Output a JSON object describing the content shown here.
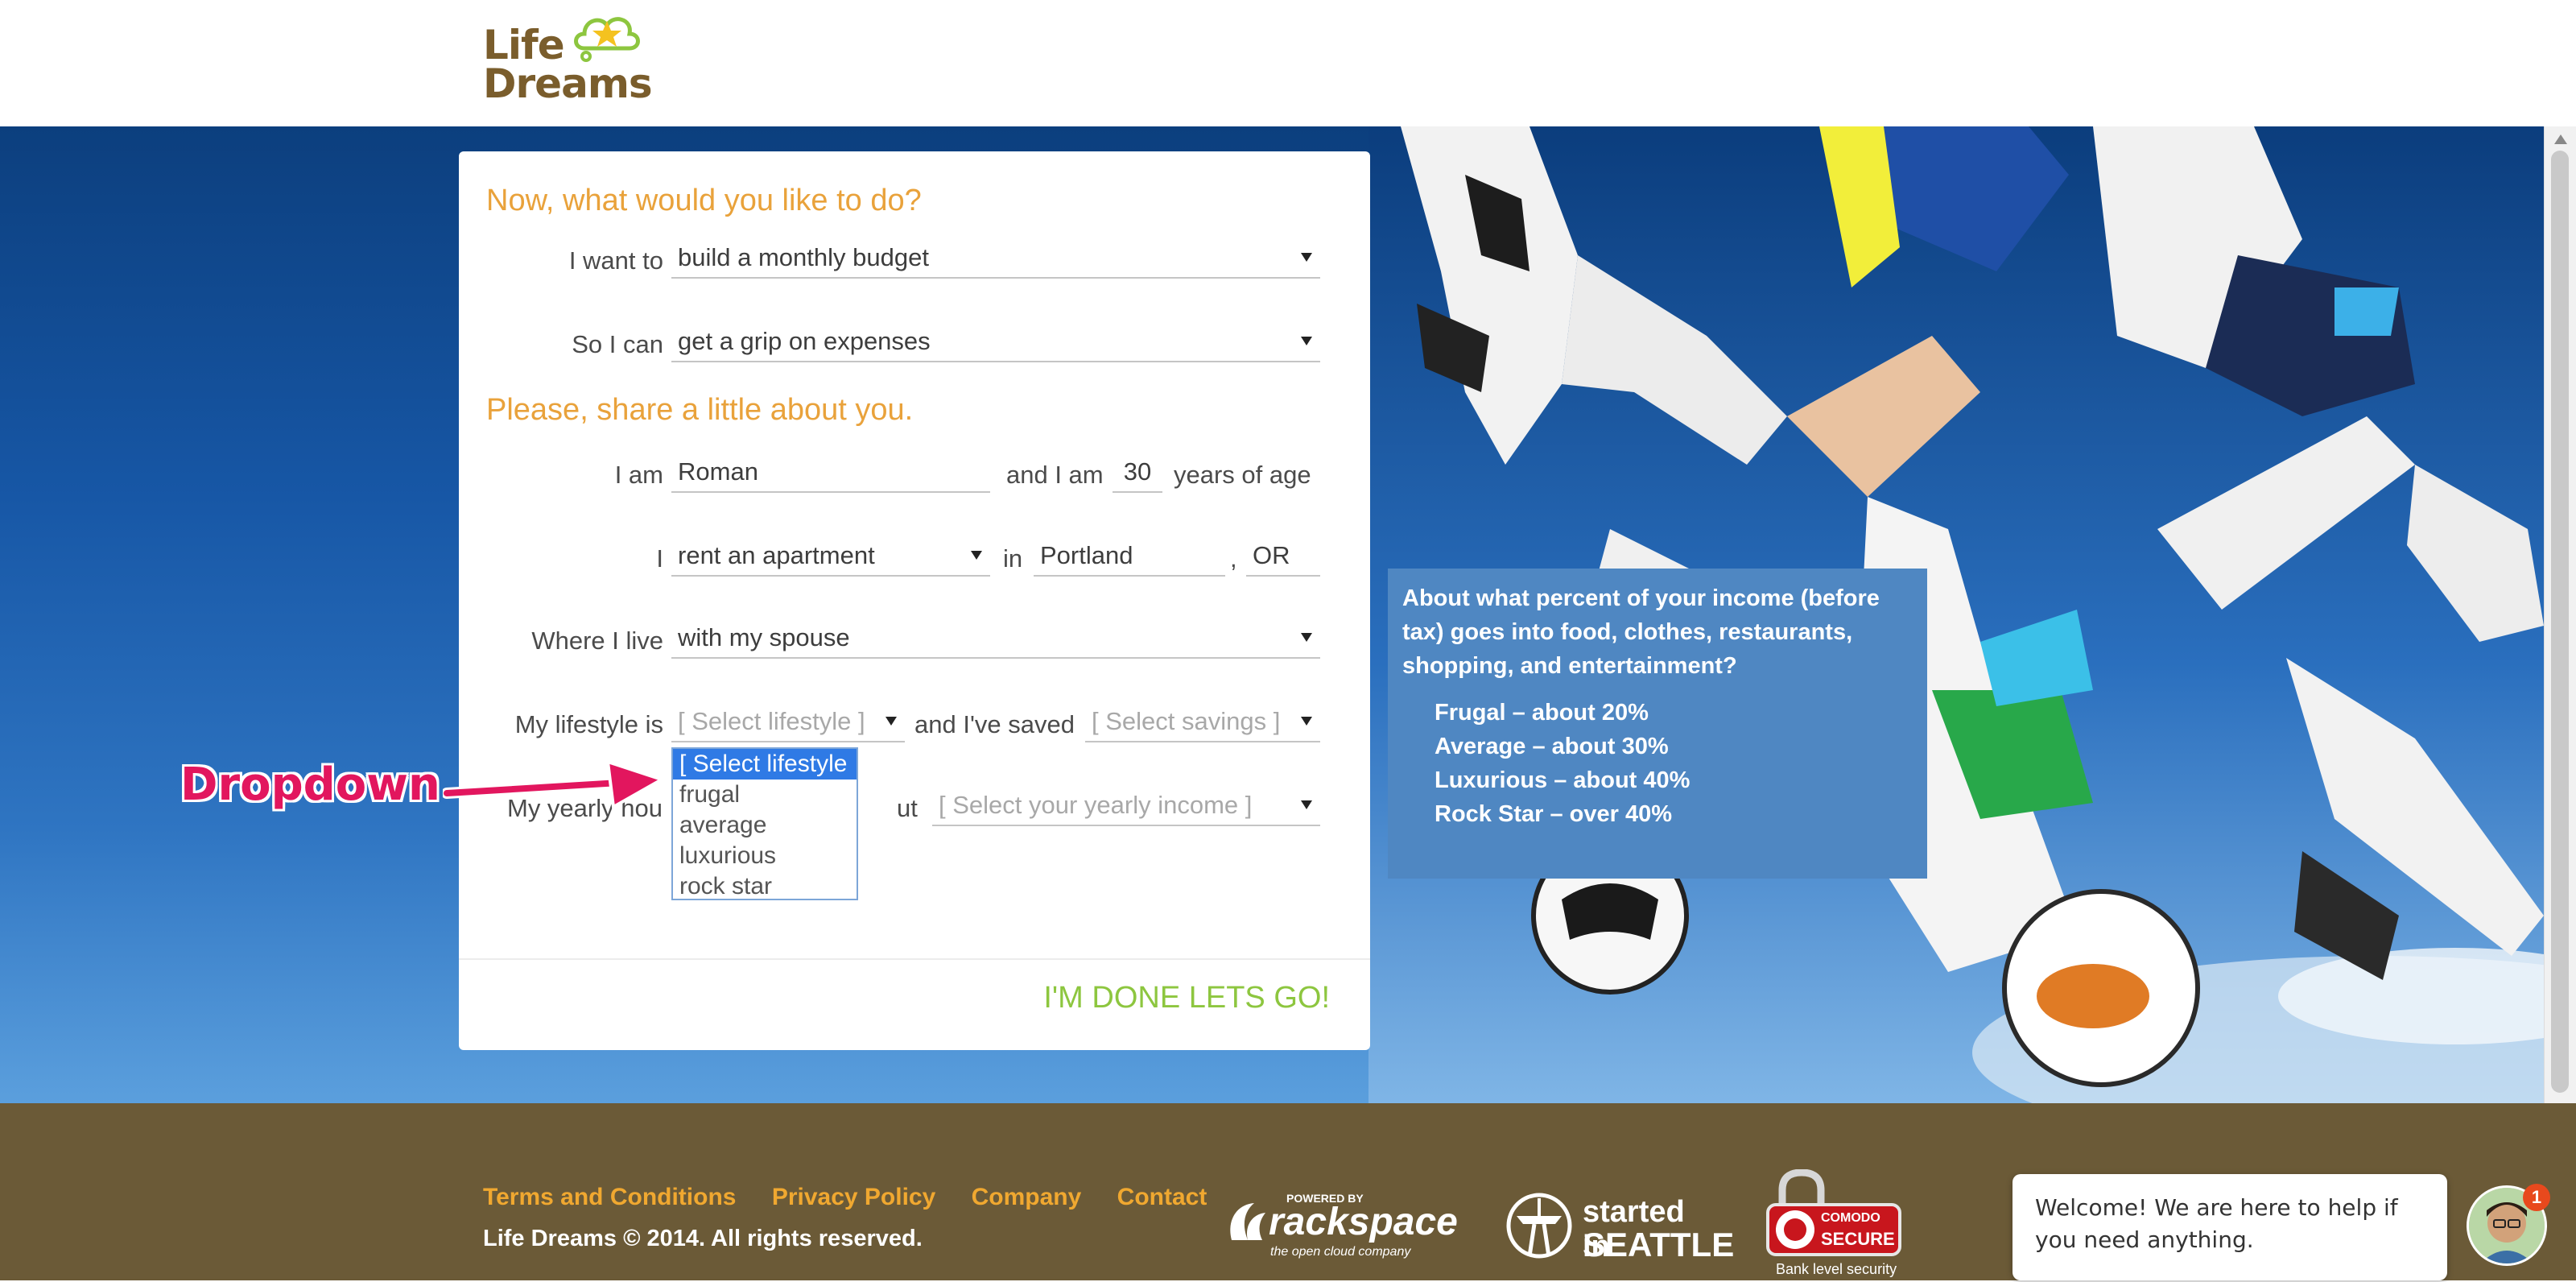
{
  "brand": {
    "logo_line1": "Life",
    "logo_line2": "Dreams"
  },
  "form": {
    "heading1": "Now, what would you like to do?",
    "want_label": "I want to",
    "want_value": "build a monthly budget",
    "can_label": "So I can",
    "can_value": "get a grip on expenses",
    "heading2": "Please, share a little about you.",
    "iam_label": "I am",
    "name_value": "Roman",
    "andiam_label": "and I am",
    "age_value": "30",
    "years_label": "years of age",
    "i_label": "I",
    "housing_value": "rent an apartment",
    "in_label": "in",
    "city_value": "Portland",
    "comma": ",",
    "state_value": "OR",
    "where_label": "Where I live",
    "where_value": "with my spouse",
    "lifestyle_label": "My lifestyle is",
    "lifestyle_placeholder": "[ Select lifestyle ]",
    "saved_label": "and I've saved",
    "savings_placeholder": "[ Select savings ]",
    "yearly_label_left": "My yearly hou",
    "yearly_label_right": "ut",
    "income_placeholder": "[ Select your yearly income ]",
    "lifestyle_options": [
      "[ Select lifestyle ]",
      "frugal",
      "average",
      "luxurious",
      "rock star"
    ],
    "done_button": "I'M DONE LETS GO!"
  },
  "info": {
    "question": "About what percent of your income (before tax) goes into food, clothes, restaurants, shopping, and entertainment?",
    "items": [
      "Frugal – about 20%",
      "Average – about 30%",
      "Luxurious – about 40%",
      "Rock Star – over 40%"
    ]
  },
  "annotation": {
    "label": "Dropdown"
  },
  "footer": {
    "links": [
      "Terms and Conditions",
      "Privacy Policy",
      "Company",
      "Contact"
    ],
    "copyright": "Life Dreams © 2014. All rights reserved.",
    "rackspace_powered": "POWERED BY",
    "rackspace_name": "rackspace",
    "rackspace_tag": "the open cloud company",
    "seattle_started": "started in",
    "seattle_city": "SEATTLE",
    "comodo_name": "COMODO",
    "comodo_secure": "SECURE",
    "comodo_caption": "Bank level security"
  },
  "chat": {
    "message": "Welcome! We are here to help if you need anything.",
    "badge_count": "1"
  },
  "colors": {
    "accent_orange": "#e9a23b",
    "accent_green": "#8dc63f",
    "footer_brown": "#6b5a37",
    "annotation_pink": "#e2165e",
    "info_blue": "#4f87c2"
  }
}
